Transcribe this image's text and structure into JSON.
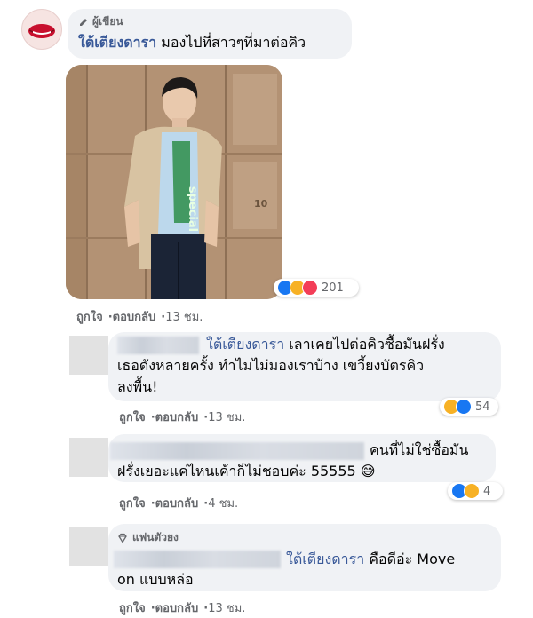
{
  "comment1": {
    "author_badge": "ผู้เขียน",
    "name": "ใต้เตียงดารา",
    "text": "มองไปที่สาวๆที่มาต่อคิว",
    "reaction_count": "201",
    "like": "ถูกใจ",
    "reply": "ตอบกลับ",
    "time": "13 ชม.",
    "photo_shirt_text": "special",
    "photo_tag": "10"
  },
  "reply1": {
    "tag": "ใต้เตียงดารา",
    "line1": "เลาเคยไปต่อคิวซื้อมันฝรั่ง",
    "line2": "เธอดังหลายครั้ง ทำไมไม่มองเราบ้าง เขวี้ยงบัตรคิว",
    "line3": "ลงพื้น!",
    "reaction_count": "54",
    "like": "ถูกใจ",
    "reply": "ตอบกลับ",
    "time": "13 ชม."
  },
  "reply2": {
    "line1": "คนที่ไม่ใช่ซื้อมัน",
    "line2": "ฝรั่งเยอะแค่ไหนเค้าก็ไม่ชอบค่ะ 55555",
    "emoji": "😅",
    "reaction_count": "4",
    "like": "ถูกใจ",
    "reply": "ตอบกลับ",
    "time": "4 ชม."
  },
  "reply3": {
    "badge": "แฟนตัวยง",
    "tag": "ใต้เตียงดารา",
    "line1": "คือดีอ่ะ Move",
    "line2": "on แบบหล่อ",
    "like": "ถูกใจ",
    "reply": "ตอบกลับ",
    "time": "13 ชม."
  },
  "colors": {
    "bubble": "#f0f2f5",
    "link": "#385898",
    "muted": "#65676b",
    "like_blue": "#1877f2",
    "haha_yellow": "#f7b125",
    "love_red": "#f33e58"
  }
}
